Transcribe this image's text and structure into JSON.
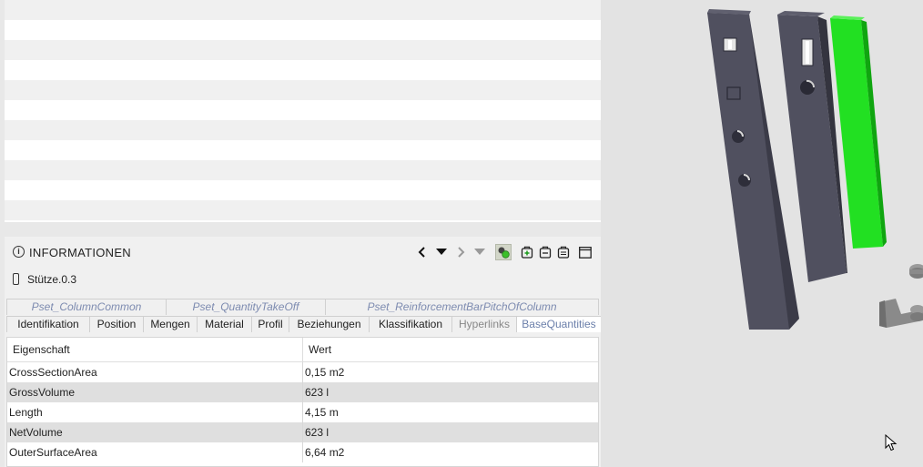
{
  "info": {
    "title": "INFORMATIONEN",
    "element_name": "Stütze.0.3"
  },
  "tabs_top": [
    {
      "label": "Pset_ColumnCommon"
    },
    {
      "label": "Pset_QuantityTakeOff"
    },
    {
      "label": "Pset_ReinforcementBarPitchOfColumn"
    }
  ],
  "tabs_bottom": [
    {
      "label": "Identifikation"
    },
    {
      "label": "Position"
    },
    {
      "label": "Mengen"
    },
    {
      "label": "Material"
    },
    {
      "label": "Profil"
    },
    {
      "label": "Beziehungen"
    },
    {
      "label": "Klassifikation"
    },
    {
      "label": "Hyperlinks"
    },
    {
      "label": "BaseQuantities"
    }
  ],
  "table": {
    "headers": [
      "Eigenschaft",
      "Wert"
    ],
    "rows": [
      {
        "name": "CrossSectionArea",
        "value": "0,15 m2"
      },
      {
        "name": "GrossVolume",
        "value": "623 l"
      },
      {
        "name": "Length",
        "value": "4,15 m"
      },
      {
        "name": "NetVolume",
        "value": "623 l"
      },
      {
        "name": "OuterSurfaceArea",
        "value": "6,64 m2"
      }
    ]
  },
  "colors": {
    "selected_column": "#22e022",
    "column_dark": "#4a4a5a",
    "selected_tab_text": "#6b7faa"
  }
}
